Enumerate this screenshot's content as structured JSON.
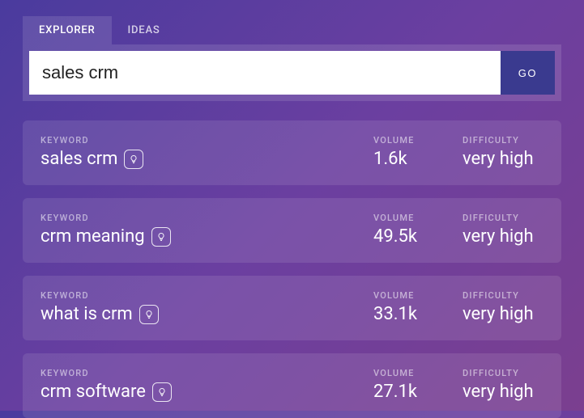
{
  "tabs": {
    "explorer": "EXPLORER",
    "ideas": "IDEAS"
  },
  "search": {
    "value": "sales crm",
    "go": "GO"
  },
  "labels": {
    "keyword": "KEYWORD",
    "volume": "VOLUME",
    "difficulty": "DIFFICULTY"
  },
  "rows": [
    {
      "keyword": "sales crm",
      "volume": "1.6k",
      "difficulty": "very high"
    },
    {
      "keyword": "crm meaning",
      "volume": "49.5k",
      "difficulty": "very high"
    },
    {
      "keyword": "what is crm",
      "volume": "33.1k",
      "difficulty": "very high"
    },
    {
      "keyword": "crm software",
      "volume": "27.1k",
      "difficulty": "very high"
    }
  ]
}
